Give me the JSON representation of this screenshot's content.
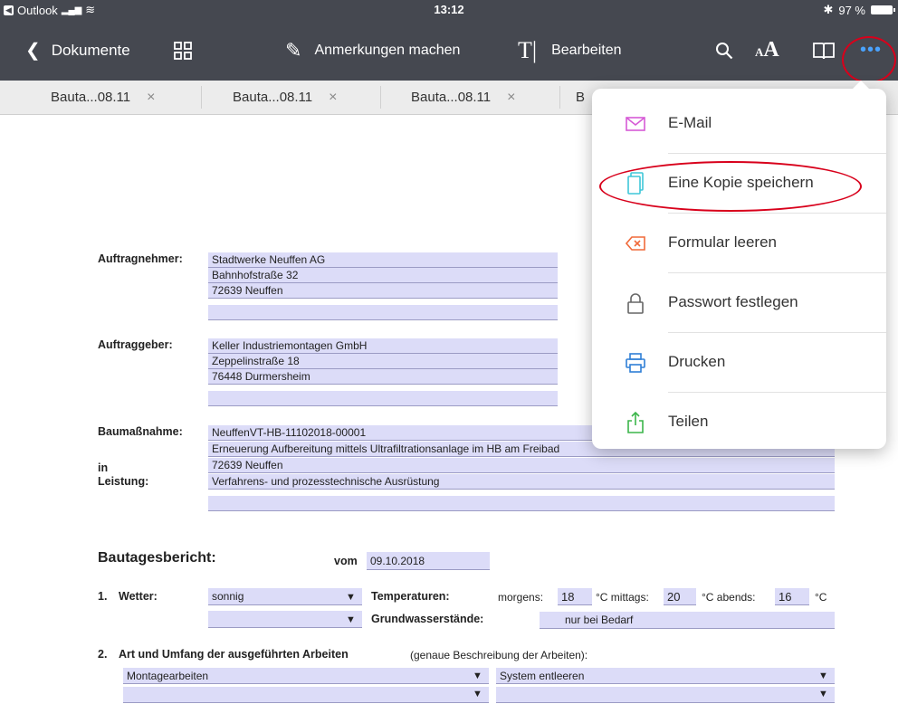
{
  "statusbar": {
    "back_app": "Outlook",
    "time": "13:12",
    "battery": "97 %"
  },
  "nav": {
    "back_label": "Dokumente",
    "annotate_label": "Anmerkungen machen",
    "edit_label": "Bearbeiten",
    "icons": [
      "chevron-left-icon",
      "grid-icon",
      "pencil-icon",
      "text-cursor-icon",
      "search-icon",
      "text-size-icon",
      "book-icon",
      "more-icon"
    ]
  },
  "tabs": [
    {
      "label": "Bauta...08.11",
      "close": "×"
    },
    {
      "label": "Bauta...08.11",
      "close": "×"
    },
    {
      "label": "Bauta...08.11",
      "close": "×"
    },
    {
      "label": "B"
    }
  ],
  "document": {
    "auftragnehmer": {
      "label": "Auftragnehmer:",
      "lines": [
        "Stadtwerke Neuffen AG",
        "Bahnhofstraße 32",
        "72639 Neuffen",
        ""
      ]
    },
    "auftraggeber": {
      "label": "Auftraggeber:",
      "lines": [
        "Keller Industriemontagen GmbH",
        "Zeppelinstraße 18",
        "76448 Durmersheim",
        ""
      ]
    },
    "baumassnahme": {
      "label": "Baumaßnahme:",
      "in_label": "in",
      "leistung_label": "Leistung:",
      "lines": [
        "NeuffenVT-HB-11102018-00001",
        "Erneuerung Aufbereitung mittels Ultrafiltrationsanlage im HB am Freibad",
        "72639 Neuffen",
        "Verfahrens- und prozesstechnische Ausrüstung",
        ""
      ]
    },
    "bericht": {
      "title": "Bautagesbericht:",
      "vom_label": "vom",
      "date": "09.10.2018"
    },
    "wetter": {
      "num": "1.",
      "label": "Wetter:",
      "value": "sonnig",
      "value2": "",
      "temp_label": "Temperaturen:",
      "gw_label": "Grundwasserstände:",
      "morgens_label": "morgens:",
      "morgens": "18",
      "mittags_label": "°C mittags:",
      "mittags": "20",
      "abends_label": "°C abends:",
      "abends": "16",
      "unit": "°C",
      "gw_value": "nur bei Bedarf"
    },
    "arbeiten": {
      "num": "2.",
      "label": "Art und Umfang der ausgeführten Arbeiten",
      "hint": "(genaue Beschreibung der Arbeiten):",
      "left": "Montagearbeiten",
      "right": "System entleeren"
    }
  },
  "menu": {
    "items": [
      {
        "label": "E-Mail",
        "icon": "mail-icon"
      },
      {
        "label": "Eine Kopie speichern",
        "icon": "copy-icon"
      },
      {
        "label": "Formular leeren",
        "icon": "clear-icon"
      },
      {
        "label": "Passwort festlegen",
        "icon": "lock-icon"
      },
      {
        "label": "Drucken",
        "icon": "print-icon"
      },
      {
        "label": "Teilen",
        "icon": "share-icon"
      }
    ]
  },
  "colors": {
    "toolbar": "#454850",
    "field": "#dcdcf8",
    "accent": "#4aa3ff",
    "highlight": "#d8001b"
  }
}
